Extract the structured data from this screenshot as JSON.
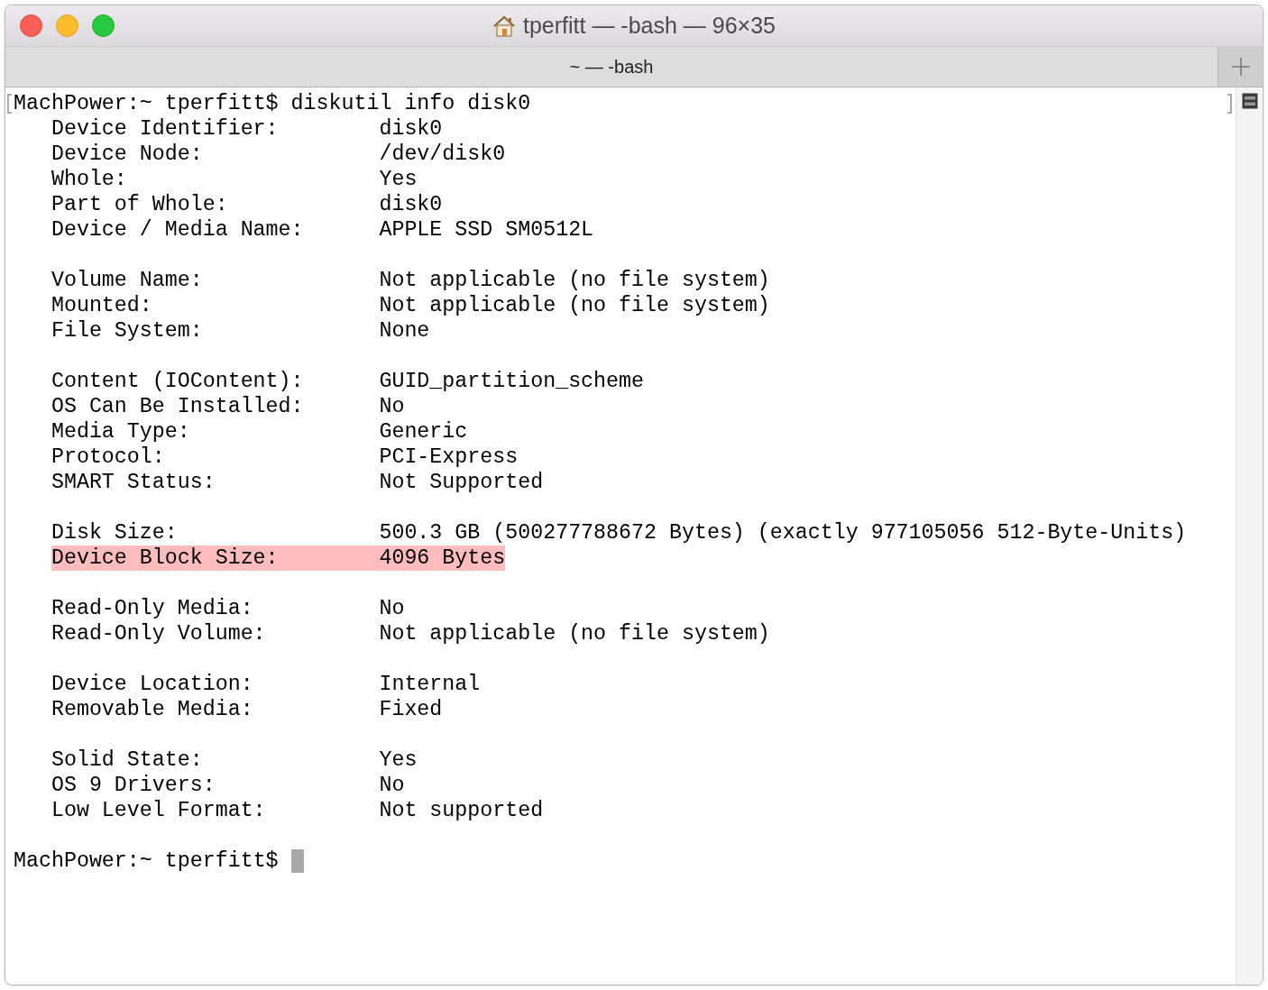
{
  "window": {
    "title": "tperfitt — -bash — 96×35"
  },
  "tabs": [
    {
      "label": "~ — -bash",
      "selected": true
    }
  ],
  "terminal": {
    "lines": [
      {
        "kind": "command",
        "text": "MachPower:~ tperfitt$ diskutil info disk0"
      },
      {
        "kind": "field",
        "label": "Device Identifier:",
        "value": "disk0",
        "highlighted": false
      },
      {
        "kind": "field",
        "label": "Device Node:",
        "value": "/dev/disk0",
        "highlighted": false
      },
      {
        "kind": "field",
        "label": "Whole:",
        "value": "Yes",
        "highlighted": false
      },
      {
        "kind": "field",
        "label": "Part of Whole:",
        "value": "disk0",
        "highlighted": false
      },
      {
        "kind": "field",
        "label": "Device / Media Name:",
        "value": "APPLE SSD SM0512L",
        "highlighted": false
      },
      {
        "kind": "blank"
      },
      {
        "kind": "field",
        "label": "Volume Name:",
        "value": "Not applicable (no file system)",
        "highlighted": false
      },
      {
        "kind": "field",
        "label": "Mounted:",
        "value": "Not applicable (no file system)",
        "highlighted": false
      },
      {
        "kind": "field",
        "label": "File System:",
        "value": "None",
        "highlighted": false
      },
      {
        "kind": "blank"
      },
      {
        "kind": "field",
        "label": "Content (IOContent):",
        "value": "GUID_partition_scheme",
        "highlighted": false
      },
      {
        "kind": "field",
        "label": "OS Can Be Installed:",
        "value": "No",
        "highlighted": false
      },
      {
        "kind": "field",
        "label": "Media Type:",
        "value": "Generic",
        "highlighted": false
      },
      {
        "kind": "field",
        "label": "Protocol:",
        "value": "PCI-Express",
        "highlighted": false
      },
      {
        "kind": "field",
        "label": "SMART Status:",
        "value": "Not Supported",
        "highlighted": false
      },
      {
        "kind": "blank"
      },
      {
        "kind": "field",
        "label": "Disk Size:",
        "value": "500.3 GB (500277788672 Bytes) (exactly 977105056 512-Byte-Units)",
        "highlighted": false
      },
      {
        "kind": "field",
        "label": "Device Block Size:",
        "value": "4096 Bytes",
        "highlighted": true
      },
      {
        "kind": "blank"
      },
      {
        "kind": "field",
        "label": "Read-Only Media:",
        "value": "No",
        "highlighted": false
      },
      {
        "kind": "field",
        "label": "Read-Only Volume:",
        "value": "Not applicable (no file system)",
        "highlighted": false
      },
      {
        "kind": "blank"
      },
      {
        "kind": "field",
        "label": "Device Location:",
        "value": "Internal",
        "highlighted": false
      },
      {
        "kind": "field",
        "label": "Removable Media:",
        "value": "Fixed",
        "highlighted": false
      },
      {
        "kind": "blank"
      },
      {
        "kind": "field",
        "label": "Solid State:",
        "value": "Yes",
        "highlighted": false
      },
      {
        "kind": "field",
        "label": "OS 9 Drivers:",
        "value": "No",
        "highlighted": false
      },
      {
        "kind": "field",
        "label": "Low Level Format:",
        "value": "Not supported",
        "highlighted": false
      },
      {
        "kind": "blank"
      },
      {
        "kind": "prompt",
        "text": "MachPower:~ tperfitt$"
      }
    ]
  }
}
